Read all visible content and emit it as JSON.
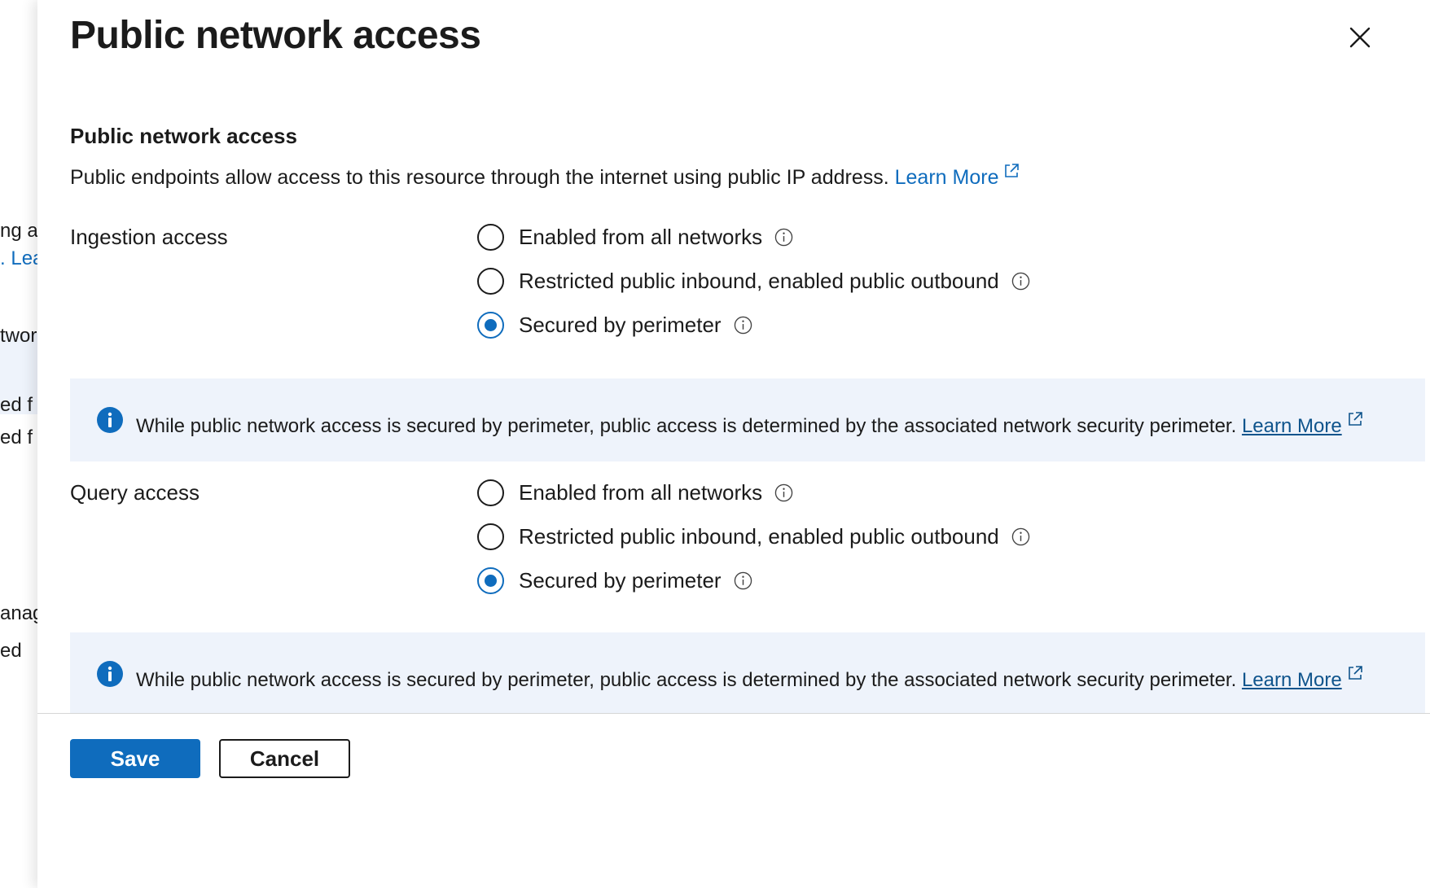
{
  "background": {
    "fragments": [
      "ng a",
      "Lea",
      "twor",
      "ed f",
      "ed f",
      "anag",
      "ed"
    ]
  },
  "panel": {
    "title": "Public network access",
    "section_heading": "Public network access",
    "description": {
      "text": "Public endpoints allow access to this resource through the internet using public IP address. ",
      "link": "Learn More"
    },
    "ingestion": {
      "label": "Ingestion access",
      "options": [
        {
          "label": "Enabled from all networks",
          "selected": false
        },
        {
          "label": "Restricted public inbound, enabled public outbound",
          "selected": false
        },
        {
          "label": "Secured by perimeter",
          "selected": true
        }
      ],
      "info_banner": {
        "text": "While public network access is secured by perimeter, public access is determined by the associated network security perimeter. ",
        "link": "Learn More"
      }
    },
    "query": {
      "label": "Query access",
      "options": [
        {
          "label": "Enabled from all networks",
          "selected": false
        },
        {
          "label": "Restricted public inbound, enabled public outbound",
          "selected": false
        },
        {
          "label": "Secured by perimeter",
          "selected": true
        }
      ],
      "info_banner": {
        "text": "While public network access is secured by perimeter, public access is determined by the associated network security perimeter. ",
        "link": "Learn More"
      }
    }
  },
  "footer": {
    "save_label": "Save",
    "cancel_label": "Cancel"
  },
  "colors": {
    "accent": "#0f6cbd",
    "banner_bg": "#eef3fb",
    "text": "#1b1b1b"
  },
  "icons": [
    "close-icon",
    "external-link-icon",
    "info-icon"
  ]
}
